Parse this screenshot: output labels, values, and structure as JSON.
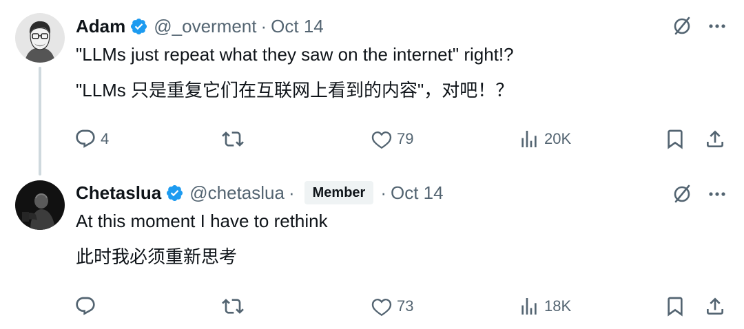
{
  "tweets": [
    {
      "author": {
        "name": "Adam",
        "handle": "@_overment",
        "verified": true,
        "badge": null
      },
      "separator": "·",
      "date": "Oct 14",
      "text_lines": [
        "\"LLMs just repeat what they saw on the internet\" right!?",
        "\"LLMs 只是重复它们在互联网上看到的内容\"，对吧！？"
      ],
      "stats": {
        "replies": "4",
        "retweets": "",
        "likes": "79",
        "views": "20K"
      }
    },
    {
      "author": {
        "name": "Chetaslua",
        "handle": "@chetaslua",
        "verified": true,
        "badge": "Member"
      },
      "separator": "·",
      "separator2": "·",
      "date": "Oct 14",
      "text_lines": [
        "At this moment I have to rethink",
        "此时我必须重新思考"
      ],
      "stats": {
        "replies": "",
        "retweets": "",
        "likes": "73",
        "views": "18K"
      }
    }
  ],
  "icons": {
    "verified": "verified-badge-icon",
    "grok": "grok-icon",
    "more": "more-icon",
    "reply": "reply-icon",
    "retweet": "retweet-icon",
    "like": "heart-icon",
    "views": "views-icon",
    "bookmark": "bookmark-icon",
    "share": "share-icon"
  },
  "colors": {
    "text_primary": "#0f1419",
    "text_secondary": "#536471",
    "verified_blue": "#1d9bf0",
    "thread_line": "#cfd9de",
    "badge_bg": "#eff3f4"
  }
}
